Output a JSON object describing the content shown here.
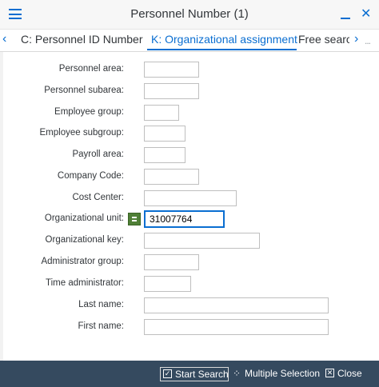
{
  "window": {
    "title": "Personnel Number (1)",
    "close_glyph": "✕"
  },
  "tabs": [
    {
      "label": "C: Personnel ID Number",
      "active": false
    },
    {
      "label": "K: Organizational assignment",
      "active": true
    },
    {
      "label": "Free search",
      "active": false
    }
  ],
  "nav": {
    "prev_glyph": "‹",
    "next_glyph": "›",
    "more_glyph": "..."
  },
  "form": {
    "fields": [
      {
        "label": "Personnel area:",
        "value": ""
      },
      {
        "label": "Personnel subarea:",
        "value": ""
      },
      {
        "label": "Employee group:",
        "value": ""
      },
      {
        "label": "Employee subgroup:",
        "value": ""
      },
      {
        "label": "Payroll area:",
        "value": ""
      },
      {
        "label": "Company Code:",
        "value": ""
      },
      {
        "label": "Cost Center:",
        "value": ""
      },
      {
        "label": "Organizational unit:",
        "value": "31007764"
      },
      {
        "label": "Organizational key:",
        "value": ""
      },
      {
        "label": "Administrator group:",
        "value": ""
      },
      {
        "label": "Time administrator:",
        "value": ""
      },
      {
        "label": "Last name:",
        "value": ""
      },
      {
        "label": "First name:",
        "value": ""
      }
    ]
  },
  "footer": {
    "start_search": "Start Search",
    "multiple_selection": "Multiple Selection",
    "close": "Close"
  },
  "colors": {
    "accent": "#0a6ed1",
    "footer_bg": "#354a5f",
    "org_unit_button": "#4f7f36"
  },
  "icons": {
    "menu": "hamburger-icon",
    "minimize": "minimize-icon",
    "close": "close-icon",
    "org_unit_selector": "list-selection-icon",
    "start_search": "checkmark-icon",
    "multiple_selection": "multiple-selection-icon",
    "close_footer": "close-box-icon"
  }
}
